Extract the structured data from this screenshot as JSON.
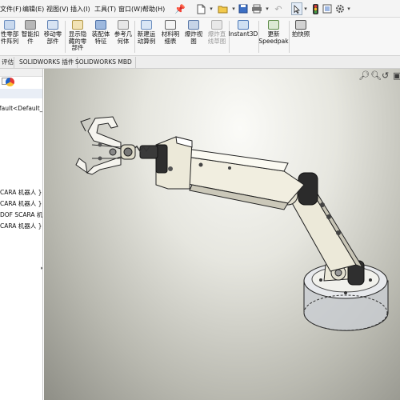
{
  "menu": {
    "file": "文件(F)",
    "edit": "编辑(E)",
    "view": "视图(V)",
    "insert": "插入(I)",
    "tools": "工具(T)",
    "window": "窗口(W)",
    "help": "帮助(H)"
  },
  "ribbon": {
    "items": [
      "性零部\n件阵列",
      "智能扣\n件",
      "移动零\n部件",
      "显示隐\n藏的零\n部件",
      "装配体\n特征",
      "参考几\n何体",
      "新建运\n动算例",
      "材料明\n细表",
      "爆炸视\n图",
      "爆炸直\n线草图",
      "Instant3D",
      "更新\nSpeedpak",
      "拍快照"
    ]
  },
  "tabs": {
    "t0": "评估",
    "t1": "SOLIDWORKS 插件",
    "t2": "SOLIDWORKS MBD"
  },
  "tree": {
    "config": "fault<Default_D",
    "rows": [
      "CARA 机器人 }",
      "CARA 机器人 }",
      "DOF SCARA 机",
      "CARA 机器人 }"
    ]
  },
  "colors": {
    "accent": "#1e63c8",
    "part": "#e9e6d6",
    "dark_part": "#2b2b2b"
  }
}
